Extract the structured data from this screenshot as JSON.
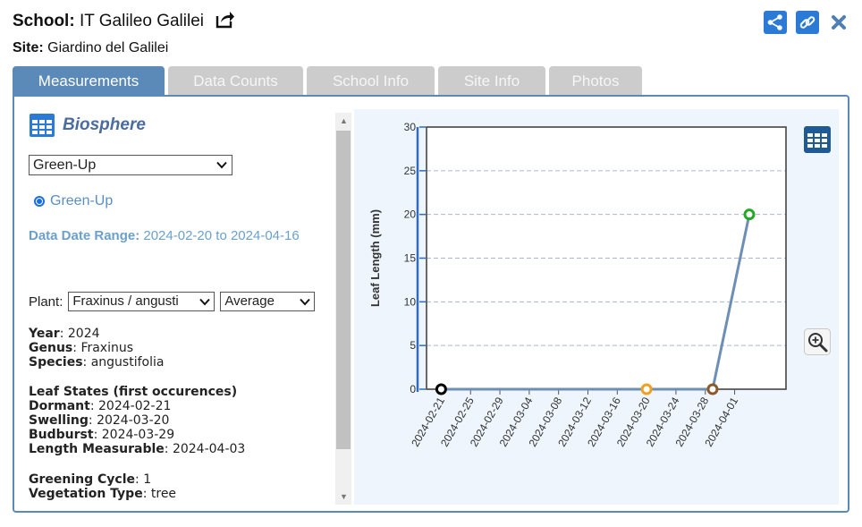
{
  "header": {
    "school_label": "School:",
    "school_name": "IT Galileo Galilei",
    "site_label": "Site:",
    "site_name": "Giardino del Galilei"
  },
  "top_icons": [
    "share-icon",
    "link-icon",
    "close-icon"
  ],
  "tabs": [
    {
      "label": "Measurements",
      "active": true
    },
    {
      "label": "Data Counts",
      "active": false
    },
    {
      "label": "School Info",
      "active": false
    },
    {
      "label": "Site Info",
      "active": false
    },
    {
      "label": "Photos",
      "active": false
    }
  ],
  "left": {
    "title": "Biosphere",
    "protocol_select": "Green-Up",
    "radio_label": "Green-Up",
    "date_range_label": "Data Date Range:",
    "date_range_value": "2024-02-20 to 2024-04-16",
    "plant_label": "Plant:",
    "plant_select": "Fraxinus / angusti",
    "stat_select": "Average",
    "year_label": "Year",
    "year_value": "2024",
    "genus_label": "Genus",
    "genus_value": "Fraxinus",
    "species_label": "Species",
    "species_value": "angustifolia",
    "leaf_states_heading": "Leaf States (first occurences)",
    "dormant_label": "Dormant",
    "dormant_value": "2024-02-21",
    "swelling_label": "Swelling",
    "swelling_value": "2024-03-20",
    "budburst_label": "Budburst",
    "budburst_value": "2024-03-29",
    "length_label": "Length Measurable",
    "length_value": "2024-04-03",
    "greening_label": "Greening Cycle",
    "greening_value": "1",
    "vegetation_label": "Vegetation Type",
    "vegetation_value": "tree"
  },
  "colors": {
    "tab_active": "#5b89b8",
    "tab_inactive": "#cccccc",
    "accent_blue": "#2b7bd6",
    "dormant_marker": "#000000",
    "swelling_marker": "#f0a020",
    "budburst_marker": "#8b5a2b",
    "length_marker": "#22aa22",
    "series_line": "#6d8fb5"
  },
  "chart_data": {
    "type": "line",
    "title": "",
    "xlabel": "",
    "ylabel": "Leaf Length (mm)",
    "ylim": [
      0,
      30
    ],
    "yticks": [
      0,
      5,
      10,
      15,
      20,
      25,
      30
    ],
    "xlim": [
      "2024-02-19",
      "2024-04-08"
    ],
    "xticks": [
      "2024-02-21",
      "2024-02-25",
      "2024-02-29",
      "2024-03-04",
      "2024-03-08",
      "2024-03-12",
      "2024-03-16",
      "2024-03-20",
      "2024-03-24",
      "2024-03-28",
      "2024-04-01"
    ],
    "grid": true,
    "x": [
      "2024-02-21",
      "2024-03-20",
      "2024-03-29",
      "2024-04-03"
    ],
    "values": [
      0,
      0,
      0,
      20
    ],
    "marker_colors": [
      "#000000",
      "#f0a020",
      "#8b5a2b",
      "#22aa22"
    ]
  }
}
